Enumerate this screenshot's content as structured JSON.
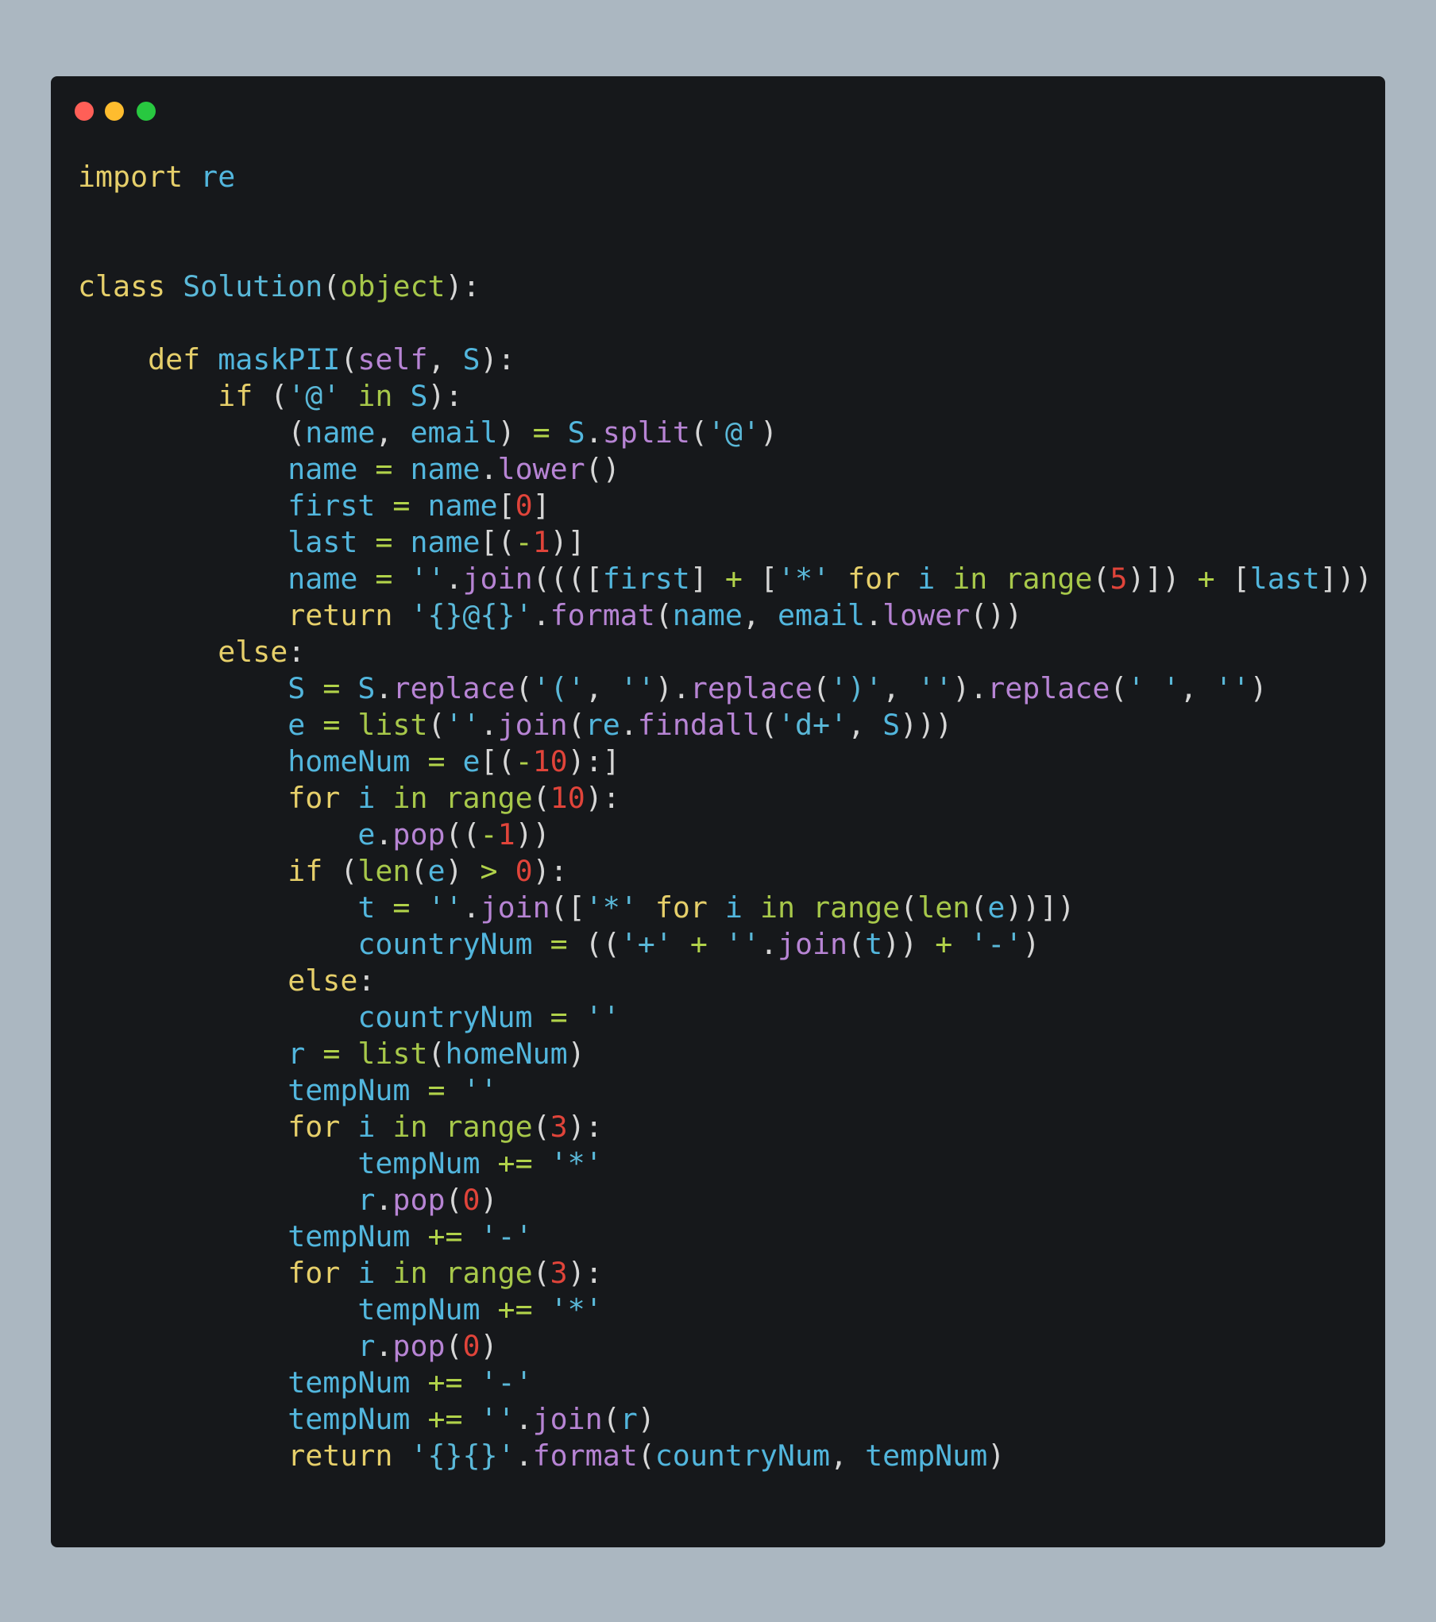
{
  "window": {
    "traffic_lights": [
      {
        "name": "close",
        "color": "#ff5f57"
      },
      {
        "name": "minimize",
        "color": "#febc2e"
      },
      {
        "name": "maximize",
        "color": "#28c840"
      }
    ]
  },
  "editor": {
    "language": "python",
    "lines": [
      [
        [
          "kw",
          "import"
        ],
        [
          "pn",
          " "
        ],
        [
          "nm",
          "re"
        ]
      ],
      [],
      [],
      [
        [
          "kw",
          "class"
        ],
        [
          "pn",
          " "
        ],
        [
          "cls",
          "Solution"
        ],
        [
          "pn",
          "("
        ],
        [
          "obj",
          "object"
        ],
        [
          "pn",
          "):"
        ]
      ],
      [],
      [
        [
          "pn",
          "    "
        ],
        [
          "kw",
          "def"
        ],
        [
          "pn",
          " "
        ],
        [
          "nm",
          "maskPII"
        ],
        [
          "pn",
          "("
        ],
        [
          "fn",
          "self"
        ],
        [
          "pn",
          ", "
        ],
        [
          "nm",
          "S"
        ],
        [
          "pn",
          "):"
        ]
      ],
      [
        [
          "pn",
          "        "
        ],
        [
          "kw",
          "if"
        ],
        [
          "pn",
          " ("
        ],
        [
          "str",
          "'@'"
        ],
        [
          "pn",
          " "
        ],
        [
          "bi",
          "in"
        ],
        [
          "pn",
          " "
        ],
        [
          "nm",
          "S"
        ],
        [
          "pn",
          "):"
        ]
      ],
      [
        [
          "pn",
          "            ("
        ],
        [
          "nm",
          "name"
        ],
        [
          "pn",
          ", "
        ],
        [
          "nm",
          "email"
        ],
        [
          "pn",
          ") "
        ],
        [
          "op",
          "="
        ],
        [
          "pn",
          " "
        ],
        [
          "nm",
          "S"
        ],
        [
          "pn",
          "."
        ],
        [
          "fn",
          "split"
        ],
        [
          "pn",
          "("
        ],
        [
          "str",
          "'@'"
        ],
        [
          "pn",
          ")"
        ]
      ],
      [
        [
          "pn",
          "            "
        ],
        [
          "nm",
          "name"
        ],
        [
          "pn",
          " "
        ],
        [
          "op",
          "="
        ],
        [
          "pn",
          " "
        ],
        [
          "nm",
          "name"
        ],
        [
          "pn",
          "."
        ],
        [
          "fn",
          "lower"
        ],
        [
          "pn",
          "()"
        ]
      ],
      [
        [
          "pn",
          "            "
        ],
        [
          "nm",
          "first"
        ],
        [
          "pn",
          " "
        ],
        [
          "op",
          "="
        ],
        [
          "pn",
          " "
        ],
        [
          "nm",
          "name"
        ],
        [
          "pn",
          "["
        ],
        [
          "num",
          "0"
        ],
        [
          "pn",
          "]"
        ]
      ],
      [
        [
          "pn",
          "            "
        ],
        [
          "nm",
          "last"
        ],
        [
          "pn",
          " "
        ],
        [
          "op",
          "="
        ],
        [
          "pn",
          " "
        ],
        [
          "nm",
          "name"
        ],
        [
          "pn",
          "[("
        ],
        [
          "op",
          "-"
        ],
        [
          "num",
          "1"
        ],
        [
          "pn",
          ")]"
        ]
      ],
      [
        [
          "pn",
          "            "
        ],
        [
          "nm",
          "name"
        ],
        [
          "pn",
          " "
        ],
        [
          "op",
          "="
        ],
        [
          "pn",
          " "
        ],
        [
          "str",
          "''"
        ],
        [
          "pn",
          "."
        ],
        [
          "fn",
          "join"
        ],
        [
          "pn",
          "(((["
        ],
        [
          "nm",
          "first"
        ],
        [
          "pn",
          "] "
        ],
        [
          "op",
          "+"
        ],
        [
          "pn",
          " ["
        ],
        [
          "str",
          "'*'"
        ],
        [
          "pn",
          " "
        ],
        [
          "kw",
          "for"
        ],
        [
          "pn",
          " "
        ],
        [
          "nm",
          "i"
        ],
        [
          "pn",
          " "
        ],
        [
          "bi",
          "in"
        ],
        [
          "pn",
          " "
        ],
        [
          "bi",
          "range"
        ],
        [
          "pn",
          "("
        ],
        [
          "num",
          "5"
        ],
        [
          "pn",
          ")]) "
        ],
        [
          "op",
          "+"
        ],
        [
          "pn",
          " ["
        ],
        [
          "nm",
          "last"
        ],
        [
          "pn",
          "]))"
        ]
      ],
      [
        [
          "pn",
          "            "
        ],
        [
          "kw",
          "return"
        ],
        [
          "pn",
          " "
        ],
        [
          "str",
          "'{}@{}'"
        ],
        [
          "pn",
          "."
        ],
        [
          "fn",
          "format"
        ],
        [
          "pn",
          "("
        ],
        [
          "nm",
          "name"
        ],
        [
          "pn",
          ", "
        ],
        [
          "nm",
          "email"
        ],
        [
          "pn",
          "."
        ],
        [
          "fn",
          "lower"
        ],
        [
          "pn",
          "())"
        ]
      ],
      [
        [
          "pn",
          "        "
        ],
        [
          "kw",
          "else"
        ],
        [
          "pn",
          ":"
        ]
      ],
      [
        [
          "pn",
          "            "
        ],
        [
          "nm",
          "S"
        ],
        [
          "pn",
          " "
        ],
        [
          "op",
          "="
        ],
        [
          "pn",
          " "
        ],
        [
          "nm",
          "S"
        ],
        [
          "pn",
          "."
        ],
        [
          "fn",
          "replace"
        ],
        [
          "pn",
          "("
        ],
        [
          "str",
          "'('"
        ],
        [
          "pn",
          ", "
        ],
        [
          "str",
          "''"
        ],
        [
          "pn",
          ")."
        ],
        [
          "fn",
          "replace"
        ],
        [
          "pn",
          "("
        ],
        [
          "str",
          "')'"
        ],
        [
          "pn",
          ", "
        ],
        [
          "str",
          "''"
        ],
        [
          "pn",
          ")."
        ],
        [
          "fn",
          "replace"
        ],
        [
          "pn",
          "("
        ],
        [
          "str",
          "' '"
        ],
        [
          "pn",
          ", "
        ],
        [
          "str",
          "''"
        ],
        [
          "pn",
          ")"
        ]
      ],
      [
        [
          "pn",
          "            "
        ],
        [
          "nm",
          "e"
        ],
        [
          "pn",
          " "
        ],
        [
          "op",
          "="
        ],
        [
          "pn",
          " "
        ],
        [
          "bi",
          "list"
        ],
        [
          "pn",
          "("
        ],
        [
          "str",
          "''"
        ],
        [
          "pn",
          "."
        ],
        [
          "fn",
          "join"
        ],
        [
          "pn",
          "("
        ],
        [
          "nm",
          "re"
        ],
        [
          "pn",
          "."
        ],
        [
          "fn",
          "findall"
        ],
        [
          "pn",
          "("
        ],
        [
          "str",
          "'d+'"
        ],
        [
          "pn",
          ", "
        ],
        [
          "nm",
          "S"
        ],
        [
          "pn",
          ")))"
        ]
      ],
      [
        [
          "pn",
          "            "
        ],
        [
          "nm",
          "homeNum"
        ],
        [
          "pn",
          " "
        ],
        [
          "op",
          "="
        ],
        [
          "pn",
          " "
        ],
        [
          "nm",
          "e"
        ],
        [
          "pn",
          "[("
        ],
        [
          "op",
          "-"
        ],
        [
          "num",
          "10"
        ],
        [
          "pn",
          "):]"
        ]
      ],
      [
        [
          "pn",
          "            "
        ],
        [
          "kw",
          "for"
        ],
        [
          "pn",
          " "
        ],
        [
          "nm",
          "i"
        ],
        [
          "pn",
          " "
        ],
        [
          "bi",
          "in"
        ],
        [
          "pn",
          " "
        ],
        [
          "bi",
          "range"
        ],
        [
          "pn",
          "("
        ],
        [
          "num",
          "10"
        ],
        [
          "pn",
          "):"
        ]
      ],
      [
        [
          "pn",
          "                "
        ],
        [
          "nm",
          "e"
        ],
        [
          "pn",
          "."
        ],
        [
          "fn",
          "pop"
        ],
        [
          "pn",
          "(("
        ],
        [
          "op",
          "-"
        ],
        [
          "num",
          "1"
        ],
        [
          "pn",
          "))"
        ]
      ],
      [
        [
          "pn",
          "            "
        ],
        [
          "kw",
          "if"
        ],
        [
          "pn",
          " ("
        ],
        [
          "bi",
          "len"
        ],
        [
          "pn",
          "("
        ],
        [
          "nm",
          "e"
        ],
        [
          "pn",
          ") "
        ],
        [
          "op",
          ">"
        ],
        [
          "pn",
          " "
        ],
        [
          "num",
          "0"
        ],
        [
          "pn",
          "):"
        ]
      ],
      [
        [
          "pn",
          "                "
        ],
        [
          "nm",
          "t"
        ],
        [
          "pn",
          " "
        ],
        [
          "op",
          "="
        ],
        [
          "pn",
          " "
        ],
        [
          "str",
          "''"
        ],
        [
          "pn",
          "."
        ],
        [
          "fn",
          "join"
        ],
        [
          "pn",
          "(["
        ],
        [
          "str",
          "'*'"
        ],
        [
          "pn",
          " "
        ],
        [
          "kw",
          "for"
        ],
        [
          "pn",
          " "
        ],
        [
          "nm",
          "i"
        ],
        [
          "pn",
          " "
        ],
        [
          "bi",
          "in"
        ],
        [
          "pn",
          " "
        ],
        [
          "bi",
          "range"
        ],
        [
          "pn",
          "("
        ],
        [
          "bi",
          "len"
        ],
        [
          "pn",
          "("
        ],
        [
          "nm",
          "e"
        ],
        [
          "pn",
          "))])"
        ]
      ],
      [
        [
          "pn",
          "                "
        ],
        [
          "nm",
          "countryNum"
        ],
        [
          "pn",
          " "
        ],
        [
          "op",
          "="
        ],
        [
          "pn",
          " (("
        ],
        [
          "str",
          "'+'"
        ],
        [
          "pn",
          " "
        ],
        [
          "op",
          "+"
        ],
        [
          "pn",
          " "
        ],
        [
          "str",
          "''"
        ],
        [
          "pn",
          "."
        ],
        [
          "fn",
          "join"
        ],
        [
          "pn",
          "("
        ],
        [
          "nm",
          "t"
        ],
        [
          "pn",
          ")) "
        ],
        [
          "op",
          "+"
        ],
        [
          "pn",
          " "
        ],
        [
          "str",
          "'-'"
        ],
        [
          "pn",
          ")"
        ]
      ],
      [
        [
          "pn",
          "            "
        ],
        [
          "kw",
          "else"
        ],
        [
          "pn",
          ":"
        ]
      ],
      [
        [
          "pn",
          "                "
        ],
        [
          "nm",
          "countryNum"
        ],
        [
          "pn",
          " "
        ],
        [
          "op",
          "="
        ],
        [
          "pn",
          " "
        ],
        [
          "str",
          "''"
        ]
      ],
      [
        [
          "pn",
          "            "
        ],
        [
          "nm",
          "r"
        ],
        [
          "pn",
          " "
        ],
        [
          "op",
          "="
        ],
        [
          "pn",
          " "
        ],
        [
          "bi",
          "list"
        ],
        [
          "pn",
          "("
        ],
        [
          "nm",
          "homeNum"
        ],
        [
          "pn",
          ")"
        ]
      ],
      [
        [
          "pn",
          "            "
        ],
        [
          "nm",
          "tempNum"
        ],
        [
          "pn",
          " "
        ],
        [
          "op",
          "="
        ],
        [
          "pn",
          " "
        ],
        [
          "str",
          "''"
        ]
      ],
      [
        [
          "pn",
          "            "
        ],
        [
          "kw",
          "for"
        ],
        [
          "pn",
          " "
        ],
        [
          "nm",
          "i"
        ],
        [
          "pn",
          " "
        ],
        [
          "bi",
          "in"
        ],
        [
          "pn",
          " "
        ],
        [
          "bi",
          "range"
        ],
        [
          "pn",
          "("
        ],
        [
          "num",
          "3"
        ],
        [
          "pn",
          "):"
        ]
      ],
      [
        [
          "pn",
          "                "
        ],
        [
          "nm",
          "tempNum"
        ],
        [
          "pn",
          " "
        ],
        [
          "op",
          "+="
        ],
        [
          "pn",
          " "
        ],
        [
          "str",
          "'*'"
        ]
      ],
      [
        [
          "pn",
          "                "
        ],
        [
          "nm",
          "r"
        ],
        [
          "pn",
          "."
        ],
        [
          "fn",
          "pop"
        ],
        [
          "pn",
          "("
        ],
        [
          "num",
          "0"
        ],
        [
          "pn",
          ")"
        ]
      ],
      [
        [
          "pn",
          "            "
        ],
        [
          "nm",
          "tempNum"
        ],
        [
          "pn",
          " "
        ],
        [
          "op",
          "+="
        ],
        [
          "pn",
          " "
        ],
        [
          "str",
          "'-'"
        ]
      ],
      [
        [
          "pn",
          "            "
        ],
        [
          "kw",
          "for"
        ],
        [
          "pn",
          " "
        ],
        [
          "nm",
          "i"
        ],
        [
          "pn",
          " "
        ],
        [
          "bi",
          "in"
        ],
        [
          "pn",
          " "
        ],
        [
          "bi",
          "range"
        ],
        [
          "pn",
          "("
        ],
        [
          "num",
          "3"
        ],
        [
          "pn",
          "):"
        ]
      ],
      [
        [
          "pn",
          "                "
        ],
        [
          "nm",
          "tempNum"
        ],
        [
          "pn",
          " "
        ],
        [
          "op",
          "+="
        ],
        [
          "pn",
          " "
        ],
        [
          "str",
          "'*'"
        ]
      ],
      [
        [
          "pn",
          "                "
        ],
        [
          "nm",
          "r"
        ],
        [
          "pn",
          "."
        ],
        [
          "fn",
          "pop"
        ],
        [
          "pn",
          "("
        ],
        [
          "num",
          "0"
        ],
        [
          "pn",
          ")"
        ]
      ],
      [
        [
          "pn",
          "            "
        ],
        [
          "nm",
          "tempNum"
        ],
        [
          "pn",
          " "
        ],
        [
          "op",
          "+="
        ],
        [
          "pn",
          " "
        ],
        [
          "str",
          "'-'"
        ]
      ],
      [
        [
          "pn",
          "            "
        ],
        [
          "nm",
          "tempNum"
        ],
        [
          "pn",
          " "
        ],
        [
          "op",
          "+="
        ],
        [
          "pn",
          " "
        ],
        [
          "str",
          "''"
        ],
        [
          "pn",
          "."
        ],
        [
          "fn",
          "join"
        ],
        [
          "pn",
          "("
        ],
        [
          "nm",
          "r"
        ],
        [
          "pn",
          ")"
        ]
      ],
      [
        [
          "pn",
          "            "
        ],
        [
          "kw",
          "return"
        ],
        [
          "pn",
          " "
        ],
        [
          "str",
          "'{}{}'"
        ],
        [
          "pn",
          "."
        ],
        [
          "fn",
          "format"
        ],
        [
          "pn",
          "("
        ],
        [
          "nm",
          "countryNum"
        ],
        [
          "pn",
          ", "
        ],
        [
          "nm",
          "tempNum"
        ],
        [
          "pn",
          ")"
        ]
      ]
    ]
  }
}
